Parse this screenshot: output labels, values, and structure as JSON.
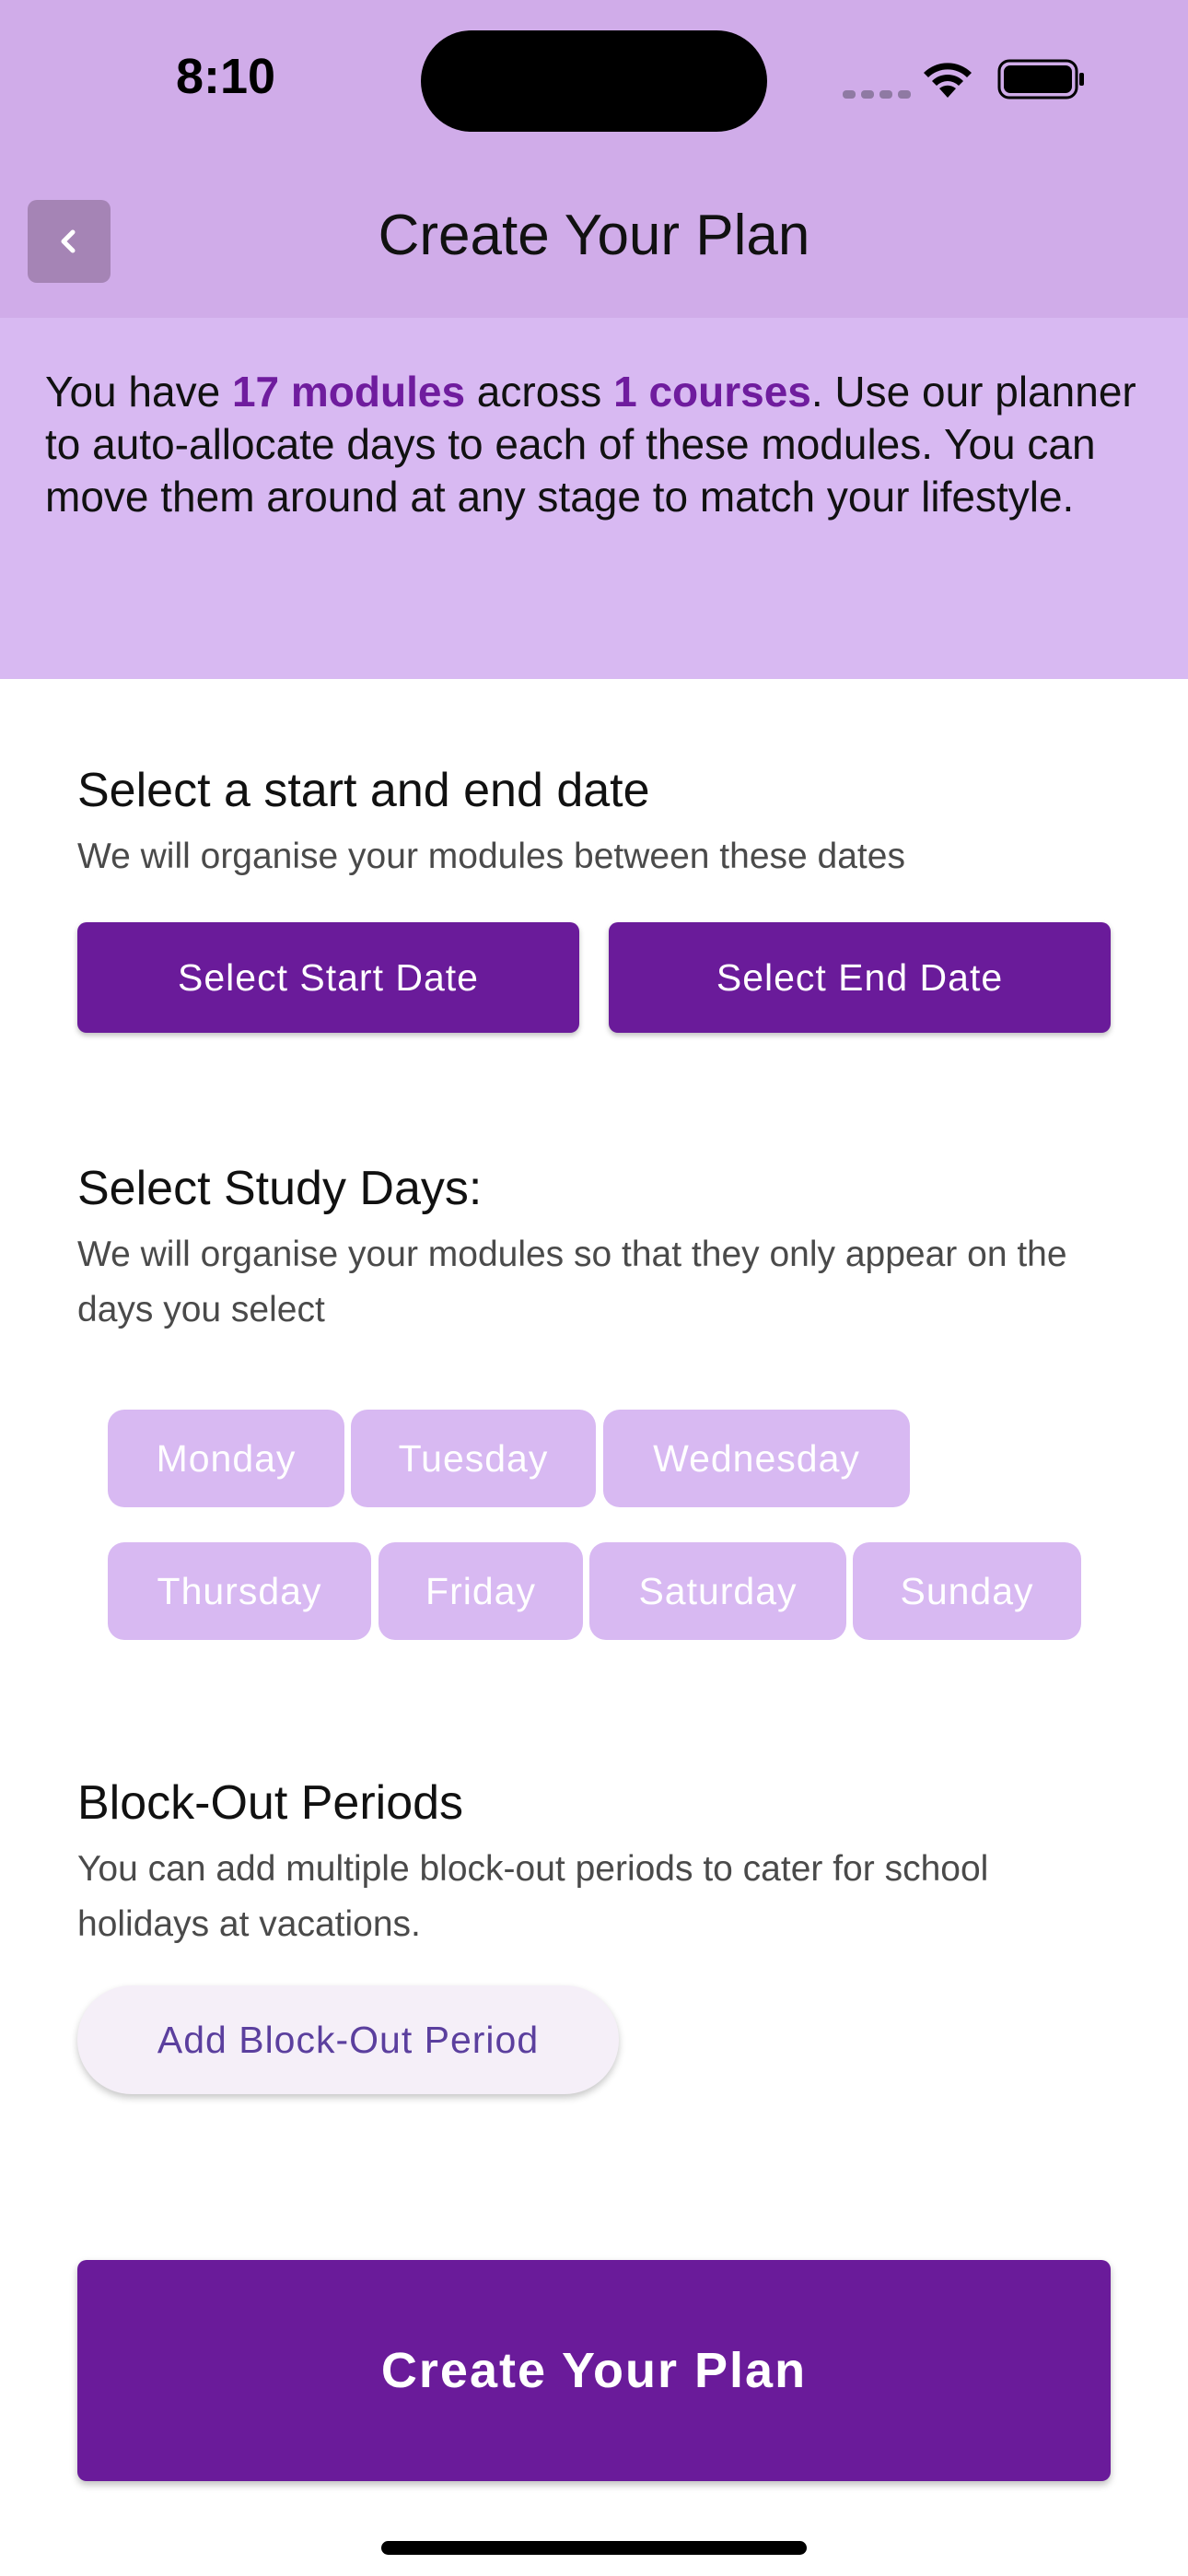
{
  "status_bar": {
    "time": "8:10"
  },
  "header": {
    "title": "Create Your Plan",
    "back_icon": "chevron-left-icon"
  },
  "intro": {
    "part1": "You have ",
    "modules_count": "17 modules",
    "part2": " across ",
    "courses_count": "1 courses",
    "part3": ". Use our planner to auto-allocate days to each of these modules. You can move them around at any stage to match your lifestyle."
  },
  "dates_section": {
    "title": "Select a start and end date",
    "description": "We will organise your modules between these dates",
    "start_label": "Select Start Date",
    "end_label": "Select End Date"
  },
  "study_days": {
    "title": "Select Study Days:",
    "description": "We will organise your modules so that they only appear on the days you select",
    "days": [
      "Monday",
      "Tuesday",
      "Wednesday",
      "Thursday",
      "Friday",
      "Saturday",
      "Sunday"
    ]
  },
  "blockout": {
    "title": "Block-Out Periods",
    "description": "You can add multiple block-out periods to cater for school holidays at vacations.",
    "add_label": "Add Block-Out Period"
  },
  "create_button": {
    "label": "Create Your Plan"
  },
  "colors": {
    "accent": "#6a1b9a",
    "header_bg": "#d0ace9",
    "intro_bg": "#d8b9f2",
    "chip_bg": "#d8b9f2"
  }
}
